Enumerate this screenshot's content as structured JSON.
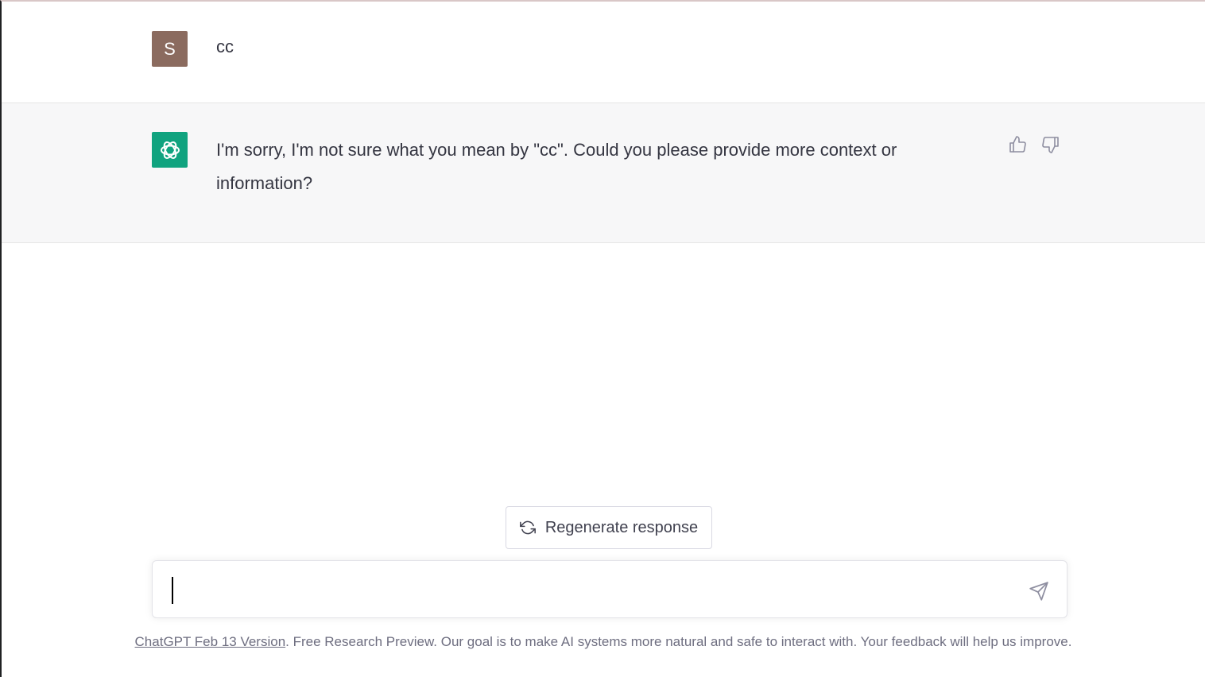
{
  "conversation": {
    "user_message": {
      "avatar_letter": "S",
      "text": "cc"
    },
    "assistant_message": {
      "text": "I'm sorry, I'm not sure what you mean by \"cc\". Could you please provide more context or information?"
    }
  },
  "actions": {
    "regenerate_label": "Regenerate response"
  },
  "composer": {
    "value": "",
    "placeholder": ""
  },
  "footer": {
    "version_link": "ChatGPT Feb 13 Version",
    "text": ". Free Research Preview. Our goal is to make AI systems more natural and safe to interact with. Your feedback will help us improve."
  },
  "icons": {
    "assistant_avatar": "openai-logo-icon",
    "thumbs_up": "thumbs-up-icon",
    "thumbs_down": "thumbs-down-icon",
    "regenerate": "refresh-icon",
    "send": "send-icon"
  },
  "colors": {
    "user_avatar_bg": "#8b6b5f",
    "assistant_avatar_bg": "#10a37f",
    "assistant_row_bg": "#f7f7f8"
  }
}
